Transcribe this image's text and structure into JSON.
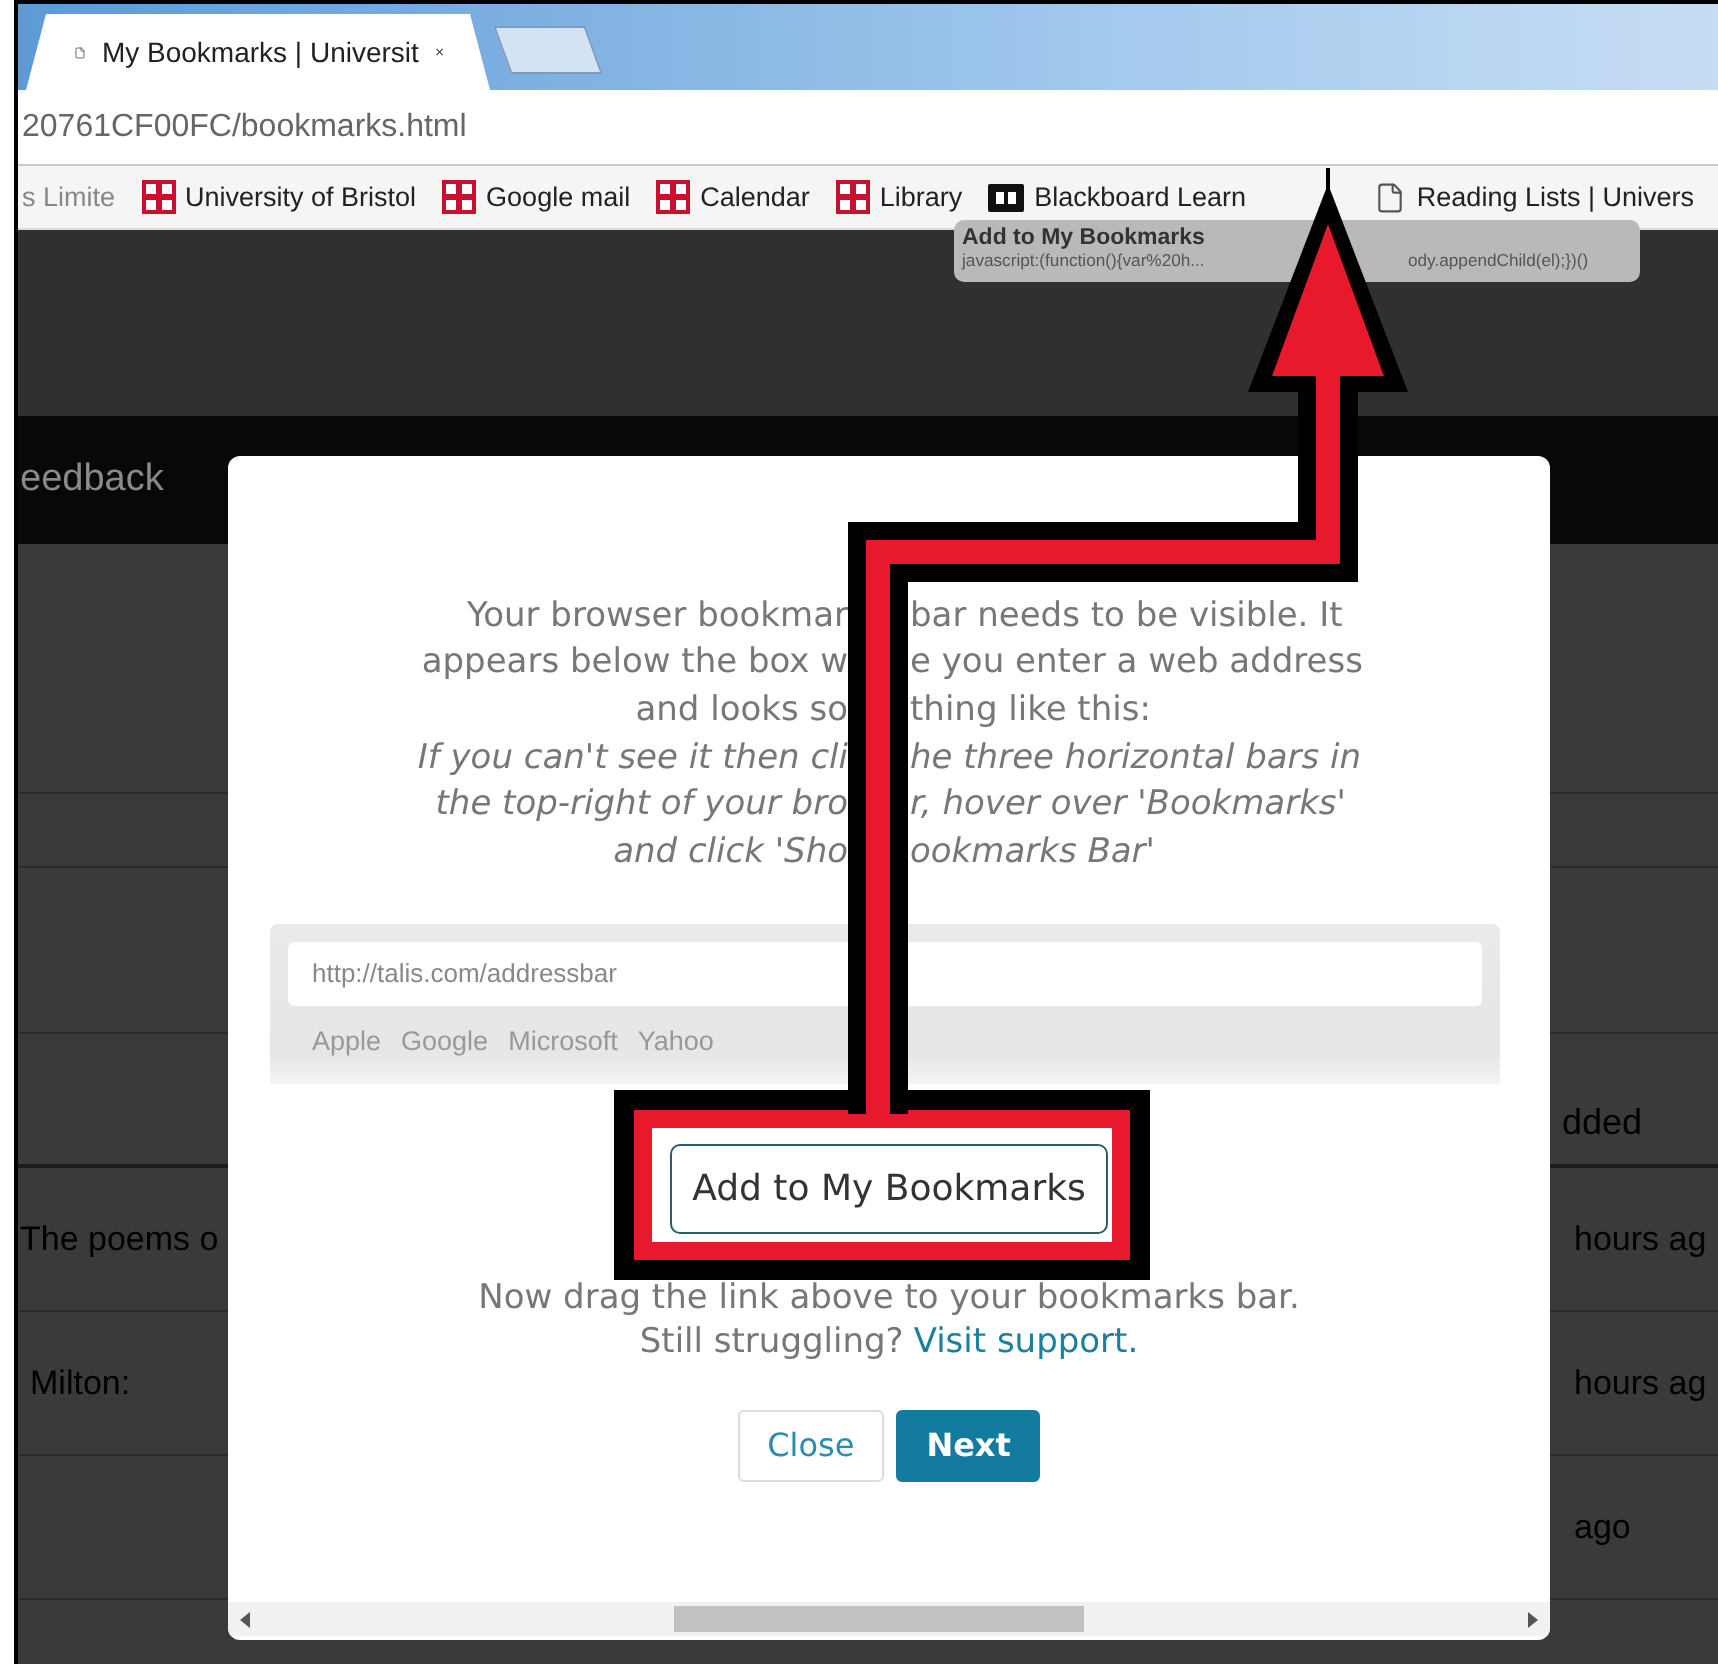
{
  "browser": {
    "tab": {
      "title": "My Bookmarks | Universit",
      "selected": true
    },
    "address": "20761CF00FC/bookmarks.html",
    "bookmarks": [
      {
        "label": "s Limite",
        "kind": "plain"
      },
      {
        "label": "University of Bristol",
        "kind": "crest"
      },
      {
        "label": "Google mail",
        "kind": "crest"
      },
      {
        "label": "Calendar",
        "kind": "crest"
      },
      {
        "label": "Library",
        "kind": "crest"
      },
      {
        "label": "Blackboard Learn",
        "kind": "board"
      },
      {
        "label": "Reading Lists | Univers",
        "kind": "page"
      }
    ],
    "tooltip": {
      "title": "Add to My Bookmarks",
      "url_parts": [
        "javascript:(function(){var%20h...",
        "ody.appendChild(el);})()"
      ]
    }
  },
  "page": {
    "nav_item": "eedback",
    "column_header": "dded",
    "rows": [
      {
        "title": "The poems o",
        "added": "hours ag"
      },
      {
        "title": "Milton:",
        "added": "hours ag"
      },
      {
        "added": "ago"
      }
    ]
  },
  "modal": {
    "lines": [
      {
        "parts": [
          "Your browser bookmar",
          "bar needs to be visible. It"
        ],
        "italic": false
      },
      {
        "parts": [
          "appears below the box w",
          "e you enter a web address"
        ],
        "italic": false
      },
      {
        "parts": [
          "and looks so",
          "thing like this:"
        ],
        "italic": false
      },
      {
        "parts": [
          "If you can't see it then cli",
          "he three horizontal bars in"
        ],
        "italic": true
      },
      {
        "parts": [
          "the top-right of your bro",
          "r, hover over 'Bookmarks'"
        ],
        "italic": true
      },
      {
        "parts": [
          "and click 'Sho",
          "ookmarks Bar'"
        ],
        "italic": true
      }
    ],
    "example": {
      "address": "http://talis.com/addressbar",
      "links": [
        "Apple",
        "Google",
        "Microsoft",
        "Yahoo"
      ]
    },
    "bookmarklet": "Add to My Bookmarks",
    "instruction": "Now drag the link above to your bookmarks bar.",
    "help": "Still struggling?",
    "help_link": "Visit support.",
    "buttons": [
      {
        "label": "Close",
        "kind": "secondary"
      },
      {
        "label": "Next",
        "kind": "primary"
      }
    ]
  }
}
